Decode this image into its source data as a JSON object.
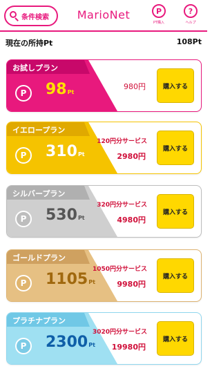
{
  "header": {
    "search_label": "条件検索",
    "title": "MarioNet",
    "pt_icon": "P",
    "pt_caption": "PT購入",
    "help_icon": "?",
    "help_caption": "ヘルプ"
  },
  "points": {
    "label": "現在の所持Pt",
    "value": "108Pt"
  },
  "plans": [
    {
      "name": "お試しプラン",
      "points": "98",
      "unit": "Pt",
      "bonus": "",
      "price": "980円",
      "button": "購入する",
      "color": "#e8197d"
    },
    {
      "name": "イエロープラン",
      "points": "310",
      "unit": "Pt",
      "bonus": "120円分サービス",
      "price": "2980円",
      "button": "購入する",
      "color": "#f5c300"
    },
    {
      "name": "シルバープラン",
      "points": "530",
      "unit": "Pt",
      "bonus": "320円分サービス",
      "price": "4980円",
      "button": "購入する",
      "color": "#cfcfcf"
    },
    {
      "name": "ゴールドプラン",
      "points": "1105",
      "unit": "Pt",
      "bonus": "1050円分サービス",
      "price": "9980円",
      "button": "購入する",
      "color": "#e6c083"
    },
    {
      "name": "プラチナプラン",
      "points": "2300",
      "unit": "Pt",
      "bonus": "3020円分サービス",
      "price": "19980円",
      "button": "購入する",
      "color": "#9fe0f2"
    }
  ],
  "icons": {
    "coin": "P"
  }
}
